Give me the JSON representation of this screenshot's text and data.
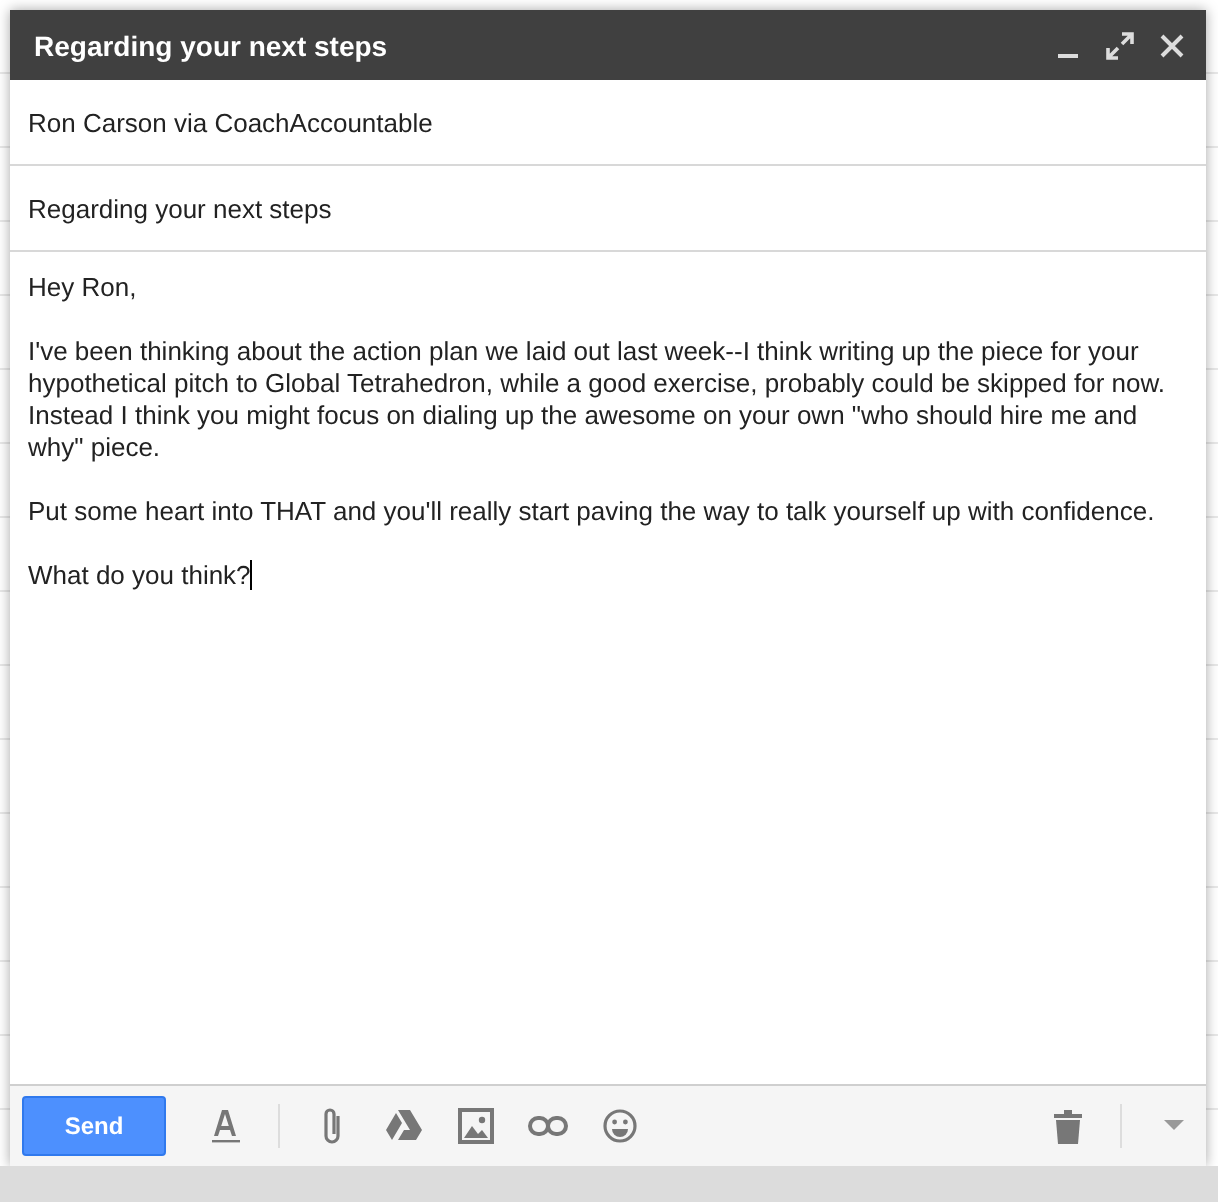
{
  "window": {
    "title": "Regarding your next steps"
  },
  "recipient": "Ron Carson via CoachAccountable",
  "subject": "Regarding your next steps",
  "body": [
    "Hey Ron,",
    "I've been thinking about the action plan we laid out last week--I think writing up the piece for your hypothetical pitch to Global Tetrahedron, while a good exercise, probably could be skipped for now. Instead I think you might focus on dialing up the awesome on your own \"who should hire me and why\" piece.",
    "Put some heart into THAT and you'll really start paving the way to talk yourself up with confidence.",
    "What do you think?"
  ],
  "send_button": "Send"
}
